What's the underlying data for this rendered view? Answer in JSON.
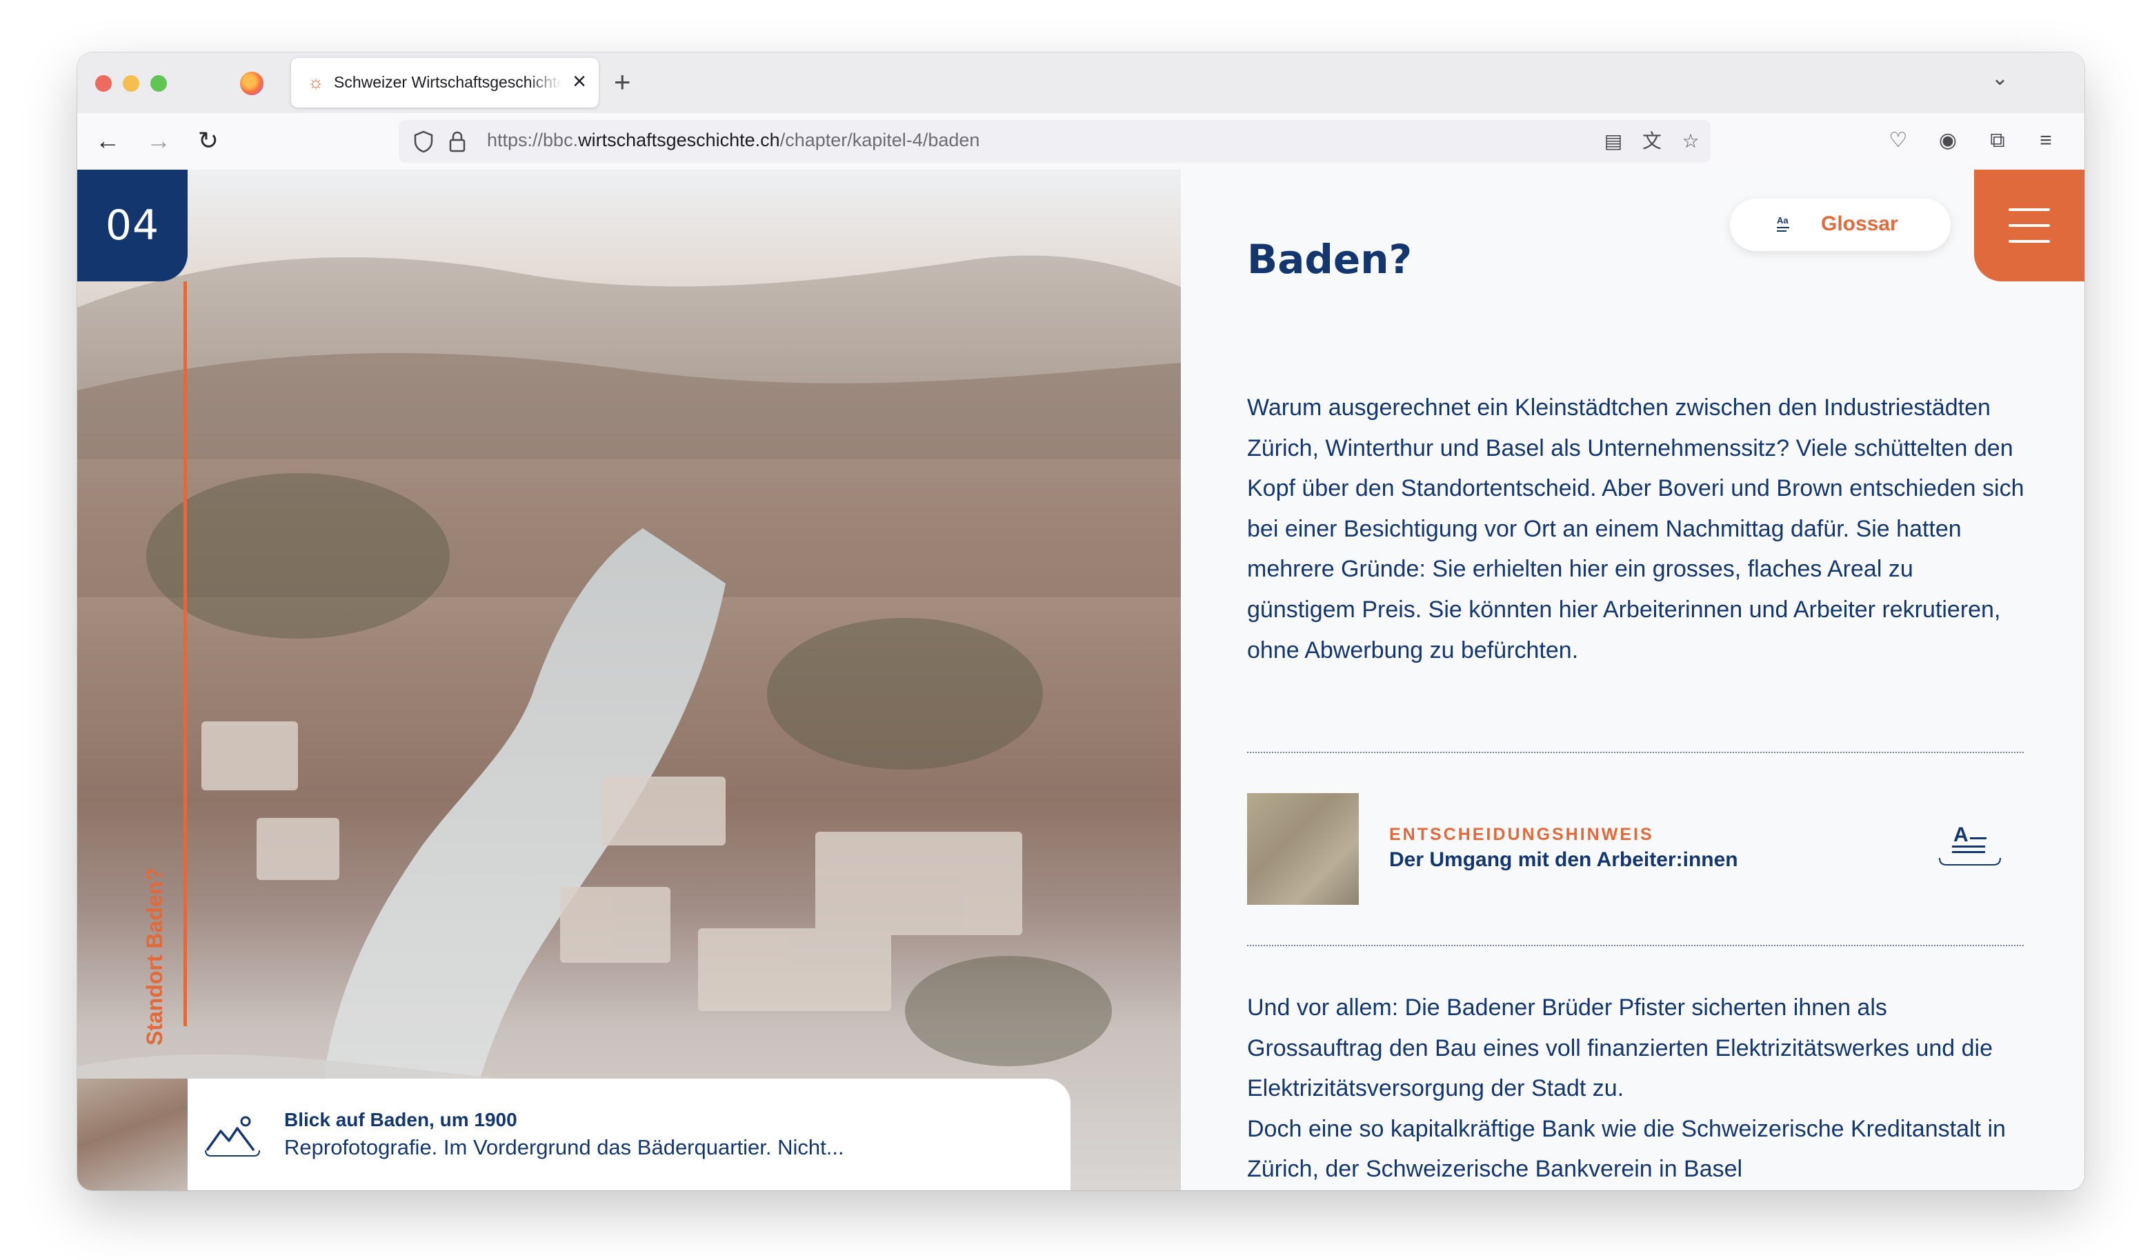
{
  "browser": {
    "tab_title": "Schweizer Wirtschaftsgeschichte",
    "url_prefix": "https://bbc.",
    "url_host": "wirtschaftsgeschichte.ch",
    "url_path": "/chapter/kapitel-4/baden"
  },
  "hero": {
    "chapter_number": "04",
    "vertical_label": "Standort Baden?",
    "caption_title": "Blick auf Baden, um 1900",
    "caption_desc": "Reprofotografie. Im Vordergrund das Bäderquartier. Nicht..."
  },
  "header": {
    "glossar_label": "Glossar",
    "glossar_icon_text": "Aa"
  },
  "article": {
    "title": "Baden?",
    "paragraph1": "Warum ausgerechnet ein Kleinstädtchen zwischen den Industriestädten Zürich, Winterthur und Basel als Unternehmenssitz? Viele schüttelten den Kopf über den Standortentscheid. Aber Boveri und Brown entschieden sich bei ei­ner Besichtigung vor Ort an einem Nachmittag dafür. Sie hatten mehrere Gründe: Sie erhielten hier ein grosses, flaches Areal zu günstigem Preis. Sie könnten hier Arbeiterinnen und Arbeiter re­krutieren, ohne Abwerbung zu befürchten.",
    "hint_kicker": "ENTSCHEIDUNGSHINWEIS",
    "hint_title": "Der Umgang mit den Arbeiter:innen",
    "hint_icon_text": "A",
    "paragraph2": "Und vor allem: Die Badener Brüder Pfister sicherten ihnen als Grossauftrag den Bau eines voll finanzierten Elektrizitätswerkes und die Elektrizitätsversorgung der Stadt zu.",
    "paragraph3": "Doch eine so kapitalkräftige Bank wie die Schweizerische Kreditanstalt in Zürich, der Schweizerische Bankverein in Basel"
  },
  "colors": {
    "navy": "#14366e",
    "accent_orange": "#e06a3b",
    "background": "#f8f9fa"
  }
}
